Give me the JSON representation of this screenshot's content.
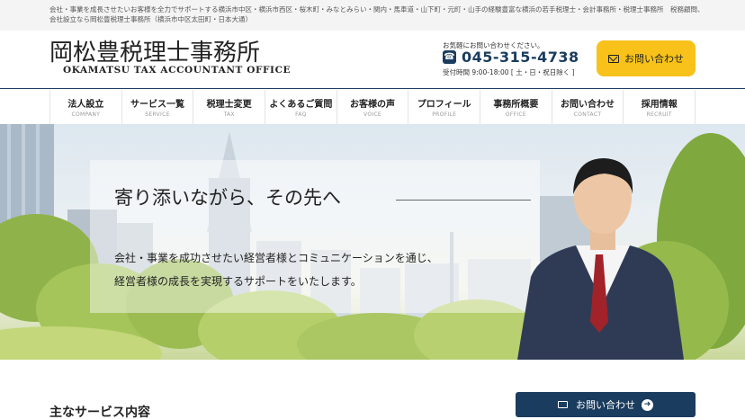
{
  "topbar": {
    "text": "会社・事業を成長させたいお客様を全力でサポートする横浜市中区・横浜市西区・桜木町・みなとみらい・関内・馬車道・山下町・元町・山手の経験豊富な横浜の若手税理士・会計事務所・税理士事務所　税務顧問、会社設立なら岡松豊税理士事務所（横浜市中区太田町・日本大通）"
  },
  "header": {
    "logo_title": "岡松豊税理士事務所",
    "logo_subtitle": "OKAMATSU TAX ACCOUNTANT OFFICE",
    "contact_note": "お気軽にお問い合わせください。",
    "phone": "045-315-4738",
    "phone_icon": "phone-icon",
    "hours": "受付時間 9:00-18:00 [ 土・日・祝日除く ]",
    "cta_label": "お問い合わせ",
    "cta_color": "#f8c21a"
  },
  "nav": {
    "items": [
      {
        "jp": "法人設立",
        "en": "COMPANY"
      },
      {
        "jp": "サービス一覧",
        "en": "SERVICE"
      },
      {
        "jp": "税理士変更",
        "en": "TAX"
      },
      {
        "jp": "よくあるご質問",
        "en": "FAQ"
      },
      {
        "jp": "お客様の声",
        "en": "VOICE"
      },
      {
        "jp": "プロフィール",
        "en": "PROFILE"
      },
      {
        "jp": "事務所概要",
        "en": "OFFICE"
      },
      {
        "jp": "お問い合わせ",
        "en": "CONTACT"
      },
      {
        "jp": "採用情報",
        "en": "RECRUIT"
      }
    ],
    "accent": "#1a3c5e"
  },
  "hero": {
    "headline": "寄り添いながら、その先へ",
    "body_line1": "会社・事業を成功させたい経営者様とコミュニケーションを通じ、",
    "body_line2": "経営者様の成長を実現するサポートをいたします。"
  },
  "services": {
    "title": "主なサービス内容",
    "cta_label": "お問い合わせ",
    "cta_color": "#1a3c5e"
  }
}
